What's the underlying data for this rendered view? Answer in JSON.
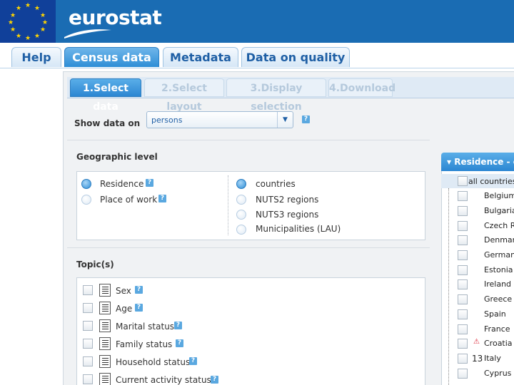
{
  "header": {
    "brand": "eurostat"
  },
  "main_tabs": [
    {
      "label": "Help"
    },
    {
      "label": "Census data"
    },
    {
      "label": "Metadata"
    },
    {
      "label": "Data on quality"
    }
  ],
  "steps": [
    {
      "label": "1.Select data"
    },
    {
      "label": "2.Select layout"
    },
    {
      "label": "3.Display selection"
    },
    {
      "label": "4.Download"
    }
  ],
  "show_data": {
    "label": "Show data on",
    "selected": "persons"
  },
  "geo": {
    "title": "Geographic level",
    "options_left": [
      "Residence",
      "Place of work"
    ],
    "options_right": [
      "countries",
      "NUTS2 regions",
      "NUTS3 regions",
      "Municipalities (LAU)"
    ]
  },
  "topics": {
    "title": "Topic(s)",
    "items": [
      "Sex",
      "Age",
      "Marital status",
      "Family status",
      "Household status",
      "Current activity status"
    ]
  },
  "tree": {
    "header": "Residence - co",
    "all": "all countries",
    "countries": [
      "Belgium",
      "Bulgaria",
      "Czech R",
      "Denmar",
      "German",
      "Estonia",
      "Ireland",
      "Greece",
      "Spain",
      "France",
      "Croatia",
      "Italy",
      "Cyprus"
    ]
  },
  "page_number": "13",
  "help_glyph": "?"
}
